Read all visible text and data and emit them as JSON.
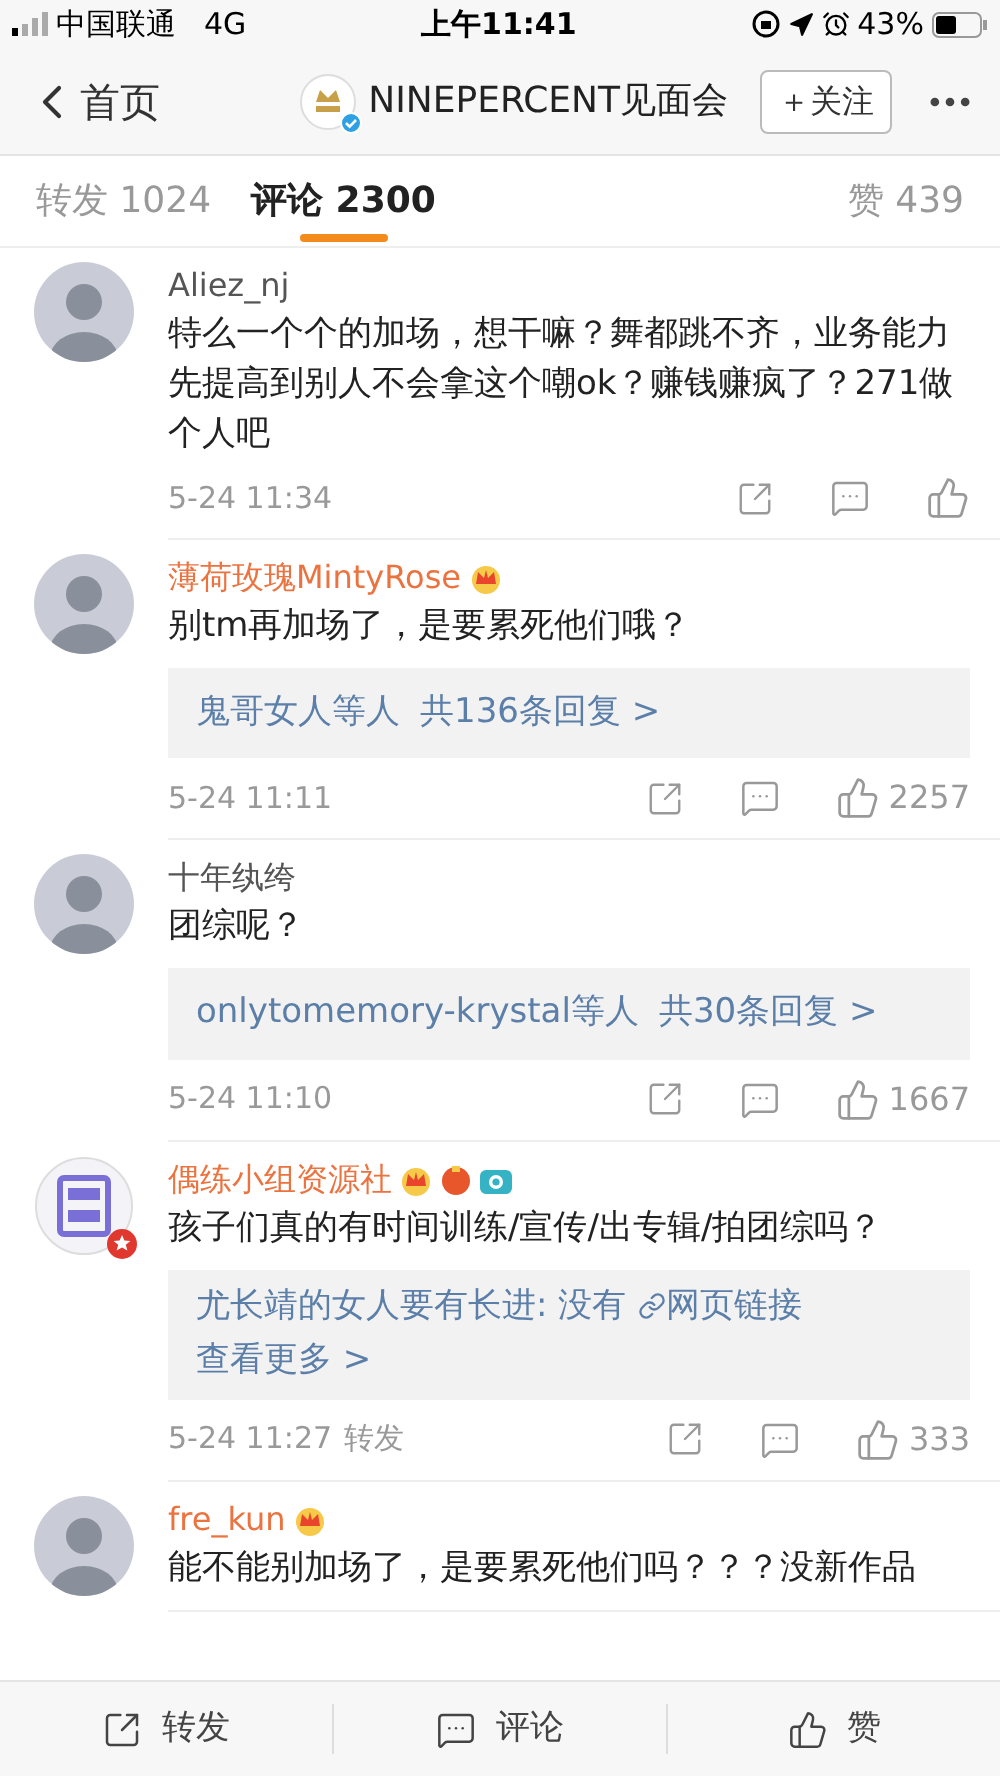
{
  "status_bar": {
    "carrier": "中国联通",
    "network": "4G",
    "time": "上午11:41",
    "battery": "43%"
  },
  "nav": {
    "back": "首页",
    "title": "NINEPERCENT见面会",
    "follow": "＋关注"
  },
  "tabs": [
    {
      "label": "转发 1024",
      "selected": false
    },
    {
      "label": "评论 2300",
      "selected": true
    },
    {
      "label": "赞 439",
      "selected": false
    }
  ],
  "comments": [
    {
      "name": "Aliez_nj",
      "vip": false,
      "avatar": {
        "kind": "photo"
      },
      "text": "特么一个个的加场，想干嘛？舞都跳不齐，业务能力先提高到别人不会拿这个嘲ok？赚钱赚疯了？271做个人吧",
      "time": "5-24 11:34"
    },
    {
      "name": "薄荷玫瑰MintyRose",
      "vip": true,
      "badges": [
        {
          "kind": "crown"
        }
      ],
      "avatar": {
        "kind": "photo"
      },
      "text": "别tm再加场了，是要累死他们哦？",
      "replies": {
        "kind": "summary",
        "who": "鬼哥女人等人",
        "count": "共136条回复 >"
      },
      "time": "5-24 11:11",
      "likes": "2257"
    },
    {
      "name": "十年纨绔",
      "vip": false,
      "avatar": {
        "kind": "photo"
      },
      "text": "团综呢？",
      "replies": {
        "kind": "summary",
        "who": "onlytomemory-krystal等人",
        "count": "共30条回复 >"
      },
      "time": "5-24 11:10",
      "likes": "1667"
    },
    {
      "name": "偶练小组资源社",
      "vip": true,
      "badges": [
        {
          "kind": "crown"
        },
        {
          "kind": "medal"
        },
        {
          "kind": "camera"
        }
      ],
      "avatar": {
        "kind": "logo"
      },
      "text": "孩子们真的有时间训练/宣传/出专辑/拍团综吗？",
      "replies": {
        "kind": "preview",
        "line": "尤长靖的女人要有长进: 没有",
        "link": "网页链接",
        "more": "查看更多 >"
      },
      "time": "5-24 11:27",
      "repost": "转发",
      "likes": "333"
    },
    {
      "name": "fre_kun",
      "vip": true,
      "badges": [
        {
          "kind": "crown"
        }
      ],
      "avatar": {
        "kind": "photo"
      },
      "text": "能不能别加场了，是要累死他们吗？？？没新作品"
    }
  ],
  "bottom_bar": [
    {
      "kind": "repost",
      "label": "转发"
    },
    {
      "kind": "comment",
      "label": "评论"
    },
    {
      "kind": "like",
      "label": "赞"
    }
  ]
}
